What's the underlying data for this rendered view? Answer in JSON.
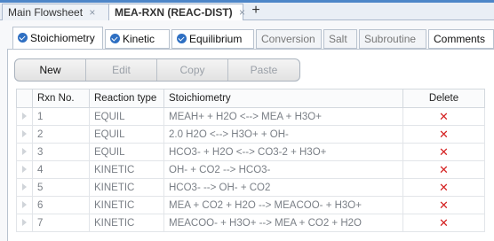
{
  "doc_tabs": [
    {
      "label": "Main Flowsheet",
      "active": false
    },
    {
      "label": "MEA-RXN (REAC-DIST)",
      "active": true
    }
  ],
  "new_tab_symbol": "+",
  "close_symbol": "×",
  "form_tabs": [
    {
      "label": "Stoichiometry",
      "checked": true,
      "selected": true
    },
    {
      "label": "Kinetic",
      "checked": true,
      "selected": false
    },
    {
      "label": "Equilibrium",
      "checked": true,
      "selected": false
    },
    {
      "label": "Conversion",
      "checked": false,
      "selected": false
    },
    {
      "label": "Salt",
      "checked": false,
      "selected": false
    },
    {
      "label": "Subroutine",
      "checked": false,
      "selected": false
    },
    {
      "label": "Comments",
      "checked": false,
      "selected": false
    }
  ],
  "toolbar": {
    "new_label": "New",
    "edit_label": "Edit",
    "copy_label": "Copy",
    "paste_label": "Paste"
  },
  "grid": {
    "columns": [
      "Rxn No.",
      "Reaction type",
      "Stoichiometry",
      "Delete"
    ],
    "delete_symbol": "✕",
    "rows": [
      {
        "no": "1",
        "type": "EQUIL",
        "stoich": "MEAH+  +  H2O  <-->  MEA  +  H3O+"
      },
      {
        "no": "2",
        "type": "EQUIL",
        "stoich": "2.0 H2O  <-->  H3O+  +  OH-"
      },
      {
        "no": "3",
        "type": "EQUIL",
        "stoich": "HCO3-  +  H2O  <-->  CO3-2  +  H3O+"
      },
      {
        "no": "4",
        "type": "KINETIC",
        "stoich": "OH-  +  CO2  -->  HCO3-"
      },
      {
        "no": "5",
        "type": "KINETIC",
        "stoich": "HCO3-  -->  OH-  +  CO2"
      },
      {
        "no": "6",
        "type": "KINETIC",
        "stoich": "MEA  +  CO2  +  H2O  -->  MEACOO-  +  H3O+"
      },
      {
        "no": "7",
        "type": "KINETIC",
        "stoich": "MEACOO-  +  H3O+  -->  MEA  +  CO2  +  H2O"
      }
    ]
  },
  "colors": {
    "accent": "#2e6fc2",
    "delete": "#d42020"
  }
}
